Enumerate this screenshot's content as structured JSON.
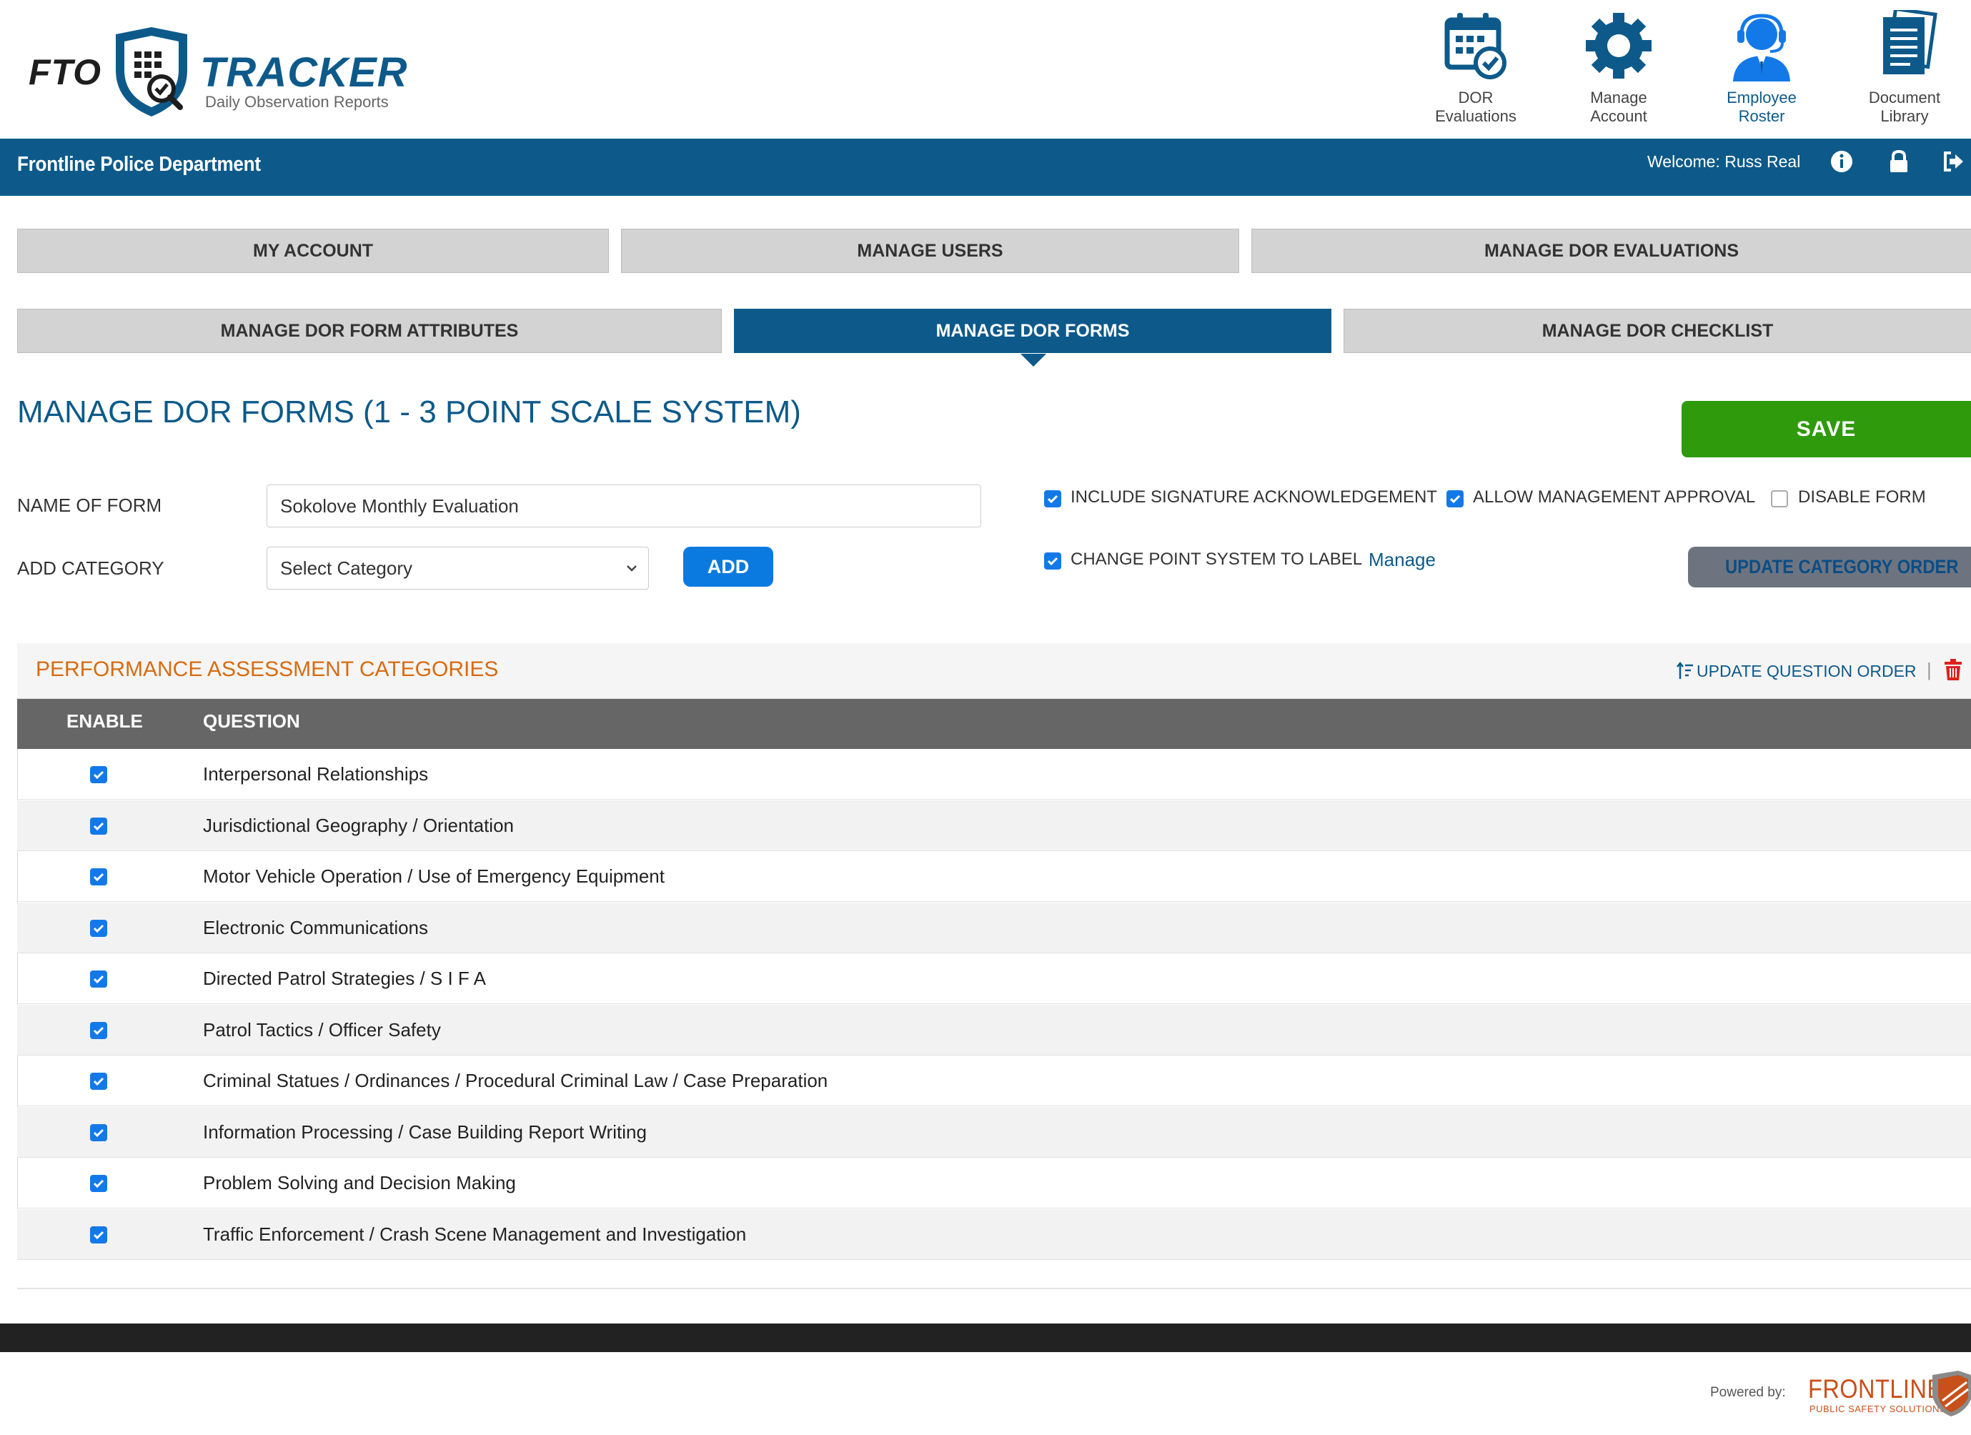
{
  "header": {
    "logo_fto": "FTO",
    "logo_tracker": "TRACKER",
    "logo_subtitle": "Daily Observation Reports",
    "nav": [
      {
        "label1": "DOR",
        "label2": "Evaluations",
        "icon": "calendar-check-icon"
      },
      {
        "label1": "Manage",
        "label2": "Account",
        "icon": "gear-icon"
      },
      {
        "label1": "Employee",
        "label2": "Roster",
        "icon": "officer-headset-icon",
        "active": true
      },
      {
        "label1": "Document",
        "label2": "Library",
        "icon": "documents-icon"
      }
    ]
  },
  "topbar": {
    "department": "Frontline Police Department",
    "welcome": "Welcome: Russ Real",
    "icons": [
      "info-icon",
      "lock-icon",
      "logout-icon"
    ]
  },
  "tabs_row1": [
    "MY ACCOUNT",
    "MANAGE USERS",
    "MANAGE DOR EVALUATIONS"
  ],
  "tabs_row2": [
    "MANAGE DOR FORM ATTRIBUTES",
    "MANAGE DOR FORMS",
    "MANAGE DOR CHECKLIST"
  ],
  "active_tab": "MANAGE DOR FORMS",
  "page": {
    "title": "MANAGE DOR FORMS (1 - 3 POINT SCALE SYSTEM)",
    "save_label": "SAVE"
  },
  "form": {
    "name_label": "NAME OF FORM",
    "name_value": "Sokolove Monthly Evaluation",
    "category_label": "ADD CATEGORY",
    "category_selected": "Select Category",
    "add_label": "ADD",
    "options": [
      {
        "label": "INCLUDE SIGNATURE ACKNOWLEDGEMENT",
        "checked": true
      },
      {
        "label": "ALLOW MANAGEMENT APPROVAL",
        "checked": true
      },
      {
        "label": "DISABLE FORM",
        "checked": false
      },
      {
        "label": "CHANGE POINT SYSTEM TO LABEL",
        "checked": true
      }
    ],
    "manage_link": "Manage",
    "update_category_order": "UPDATE CATEGORY ORDER"
  },
  "panel": {
    "title": "PERFORMANCE ASSESSMENT CATEGORIES",
    "update_question_order": "UPDATE QUESTION ORDER",
    "separator": "|",
    "columns": [
      "ENABLE",
      "QUESTION"
    ],
    "rows": [
      {
        "enabled": true,
        "question": "Interpersonal Relationships"
      },
      {
        "enabled": true,
        "question": "Jurisdictional Geography / Orientation"
      },
      {
        "enabled": true,
        "question": "Motor Vehicle Operation / Use of Emergency Equipment"
      },
      {
        "enabled": true,
        "question": "Electronic Communications"
      },
      {
        "enabled": true,
        "question": "Directed Patrol Strategies / S I F A"
      },
      {
        "enabled": true,
        "question": "Patrol Tactics / Officer Safety"
      },
      {
        "enabled": true,
        "question": "Criminal Statues / Ordinances / Procedural Criminal Law / Case Preparation"
      },
      {
        "enabled": true,
        "question": "Information Processing / Case Building Report Writing"
      },
      {
        "enabled": true,
        "question": "Problem Solving and Decision Making"
      },
      {
        "enabled": true,
        "question": "Traffic Enforcement / Crash Scene Management and Investigation"
      }
    ]
  },
  "footer": {
    "powered_by": "Powered by:",
    "brand": "FRONTLINE",
    "brand_sub": "PUBLIC SAFETY SOLUTIONS"
  },
  "colors": {
    "brand_blue": "#0d5a8a",
    "save_green": "#2e9a0c",
    "accent_orange": "#d86b10",
    "checkbox_blue": "#1479e8"
  }
}
